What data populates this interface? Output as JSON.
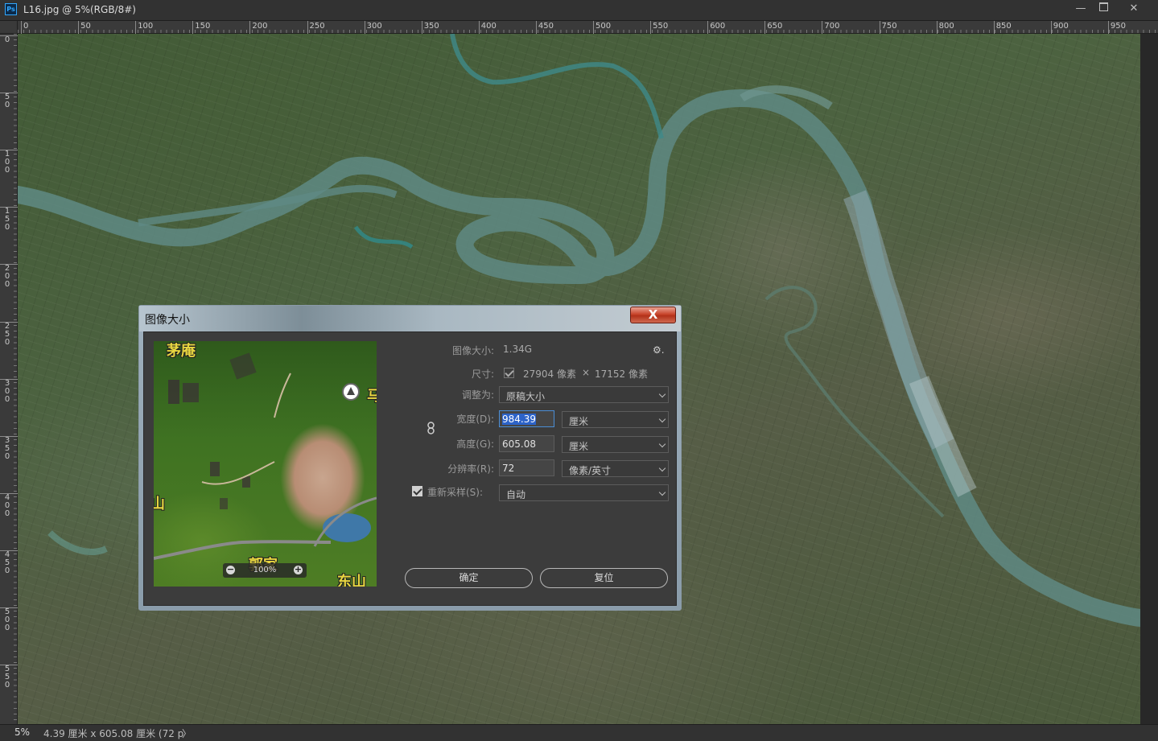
{
  "window": {
    "app_icon_label": "Ps",
    "title": "L16.jpg @ 5%(RGB/8#)",
    "minimize_label": "—",
    "close_label": "✕"
  },
  "ruler": {
    "horizontal": [
      "0",
      "50",
      "100",
      "150",
      "200",
      "250",
      "300",
      "350",
      "400",
      "450",
      "500",
      "550",
      "600",
      "650",
      "700",
      "750",
      "800",
      "850",
      "900",
      "950"
    ],
    "vertical": [
      "0",
      "5 0",
      "1 0 0",
      "1 5 0",
      "2 0 0",
      "2 5 0",
      "3 0 0",
      "3 5 0",
      "4 0 0",
      "4 5 0",
      "5 0 0",
      "5 5 0"
    ]
  },
  "dialog": {
    "title": "图像大小",
    "close_label": "X",
    "gear_label": "⚙.",
    "preview": {
      "zoom": "100%",
      "zoom_out": "−",
      "zoom_in": "+",
      "map_labels": {
        "top_left": "茅庵",
        "right": "马",
        "left": "山",
        "bottom_mid": "郭家",
        "bottom_right": "东山"
      }
    },
    "image_size_label": "图像大小:",
    "image_size_value": "1.34G",
    "dimensions_label": "尺寸:",
    "dimensions_width": "27904 像素",
    "dimensions_times": "×",
    "dimensions_height": "17152 像素",
    "fit_to_label": "调整为:",
    "fit_to_value": "原稿大小",
    "width_label": "宽度(D):",
    "width_value": "984.39",
    "width_unit": "厘米",
    "height_label": "高度(G):",
    "height_value": "605.08",
    "height_unit": "厘米",
    "resolution_label": "分辨率(R):",
    "resolution_value": "72",
    "resolution_unit": "像素/英寸",
    "resample_label": "重新采样(S):",
    "resample_checked": true,
    "resample_value": "自动",
    "ok_label": "确定",
    "reset_label": "复位"
  },
  "status": {
    "zoom": "5%",
    "info": "4.39 厘米 x 605.08 厘米 (72 p",
    "arrow": "〉"
  }
}
